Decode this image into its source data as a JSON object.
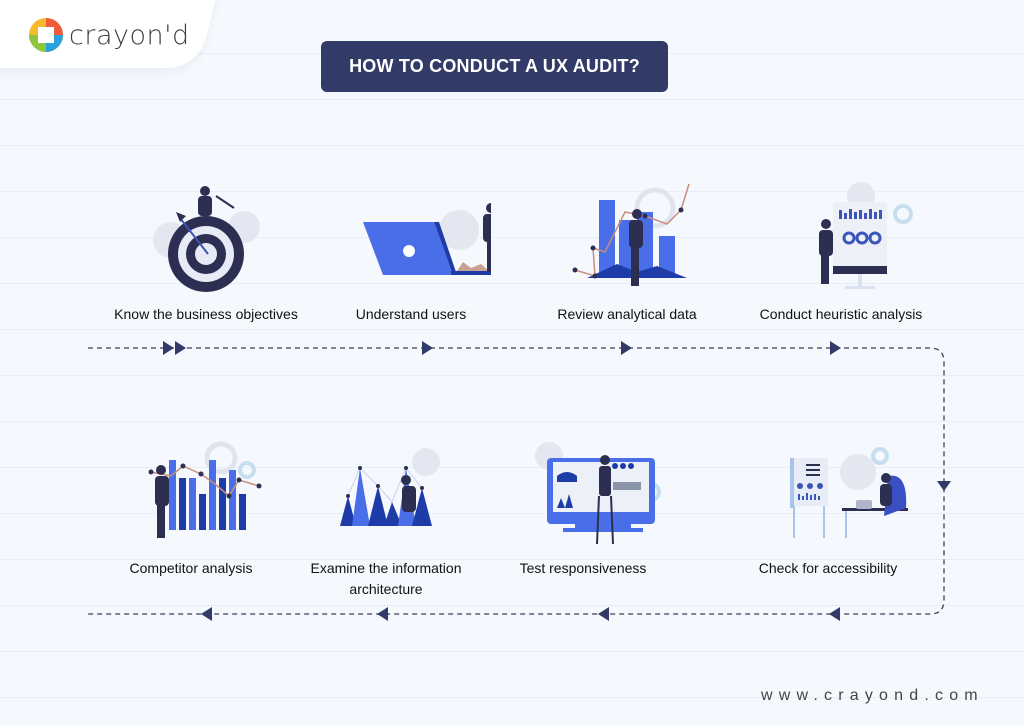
{
  "brand": {
    "name": "crayon'd",
    "website": "www.crayond.com"
  },
  "title": "HOW TO CONDUCT A UX AUDIT?",
  "colors": {
    "navy": "#323a68",
    "blue": "#4a6ee8",
    "darkblue": "#1e3ca8",
    "background": "#f5f9fd"
  },
  "steps": [
    {
      "order": 1,
      "label": "Know the business objectives",
      "icon": "target-icon"
    },
    {
      "order": 2,
      "label": "Understand users",
      "icon": "laptop-icon"
    },
    {
      "order": 3,
      "label": "Review analytical data",
      "icon": "bar-chart-icon"
    },
    {
      "order": 4,
      "label": "Conduct heuristic analysis",
      "icon": "dashboard-board-icon"
    },
    {
      "order": 5,
      "label": "Check for accessibility",
      "icon": "desk-presentation-icon"
    },
    {
      "order": 6,
      "label": "Test responsiveness",
      "icon": "monitor-icon"
    },
    {
      "order": 7,
      "label": "Examine the information architecture",
      "icon": "triangles-network-icon"
    },
    {
      "order": 8,
      "label": "Competitor analysis",
      "icon": "comparison-chart-icon"
    }
  ]
}
